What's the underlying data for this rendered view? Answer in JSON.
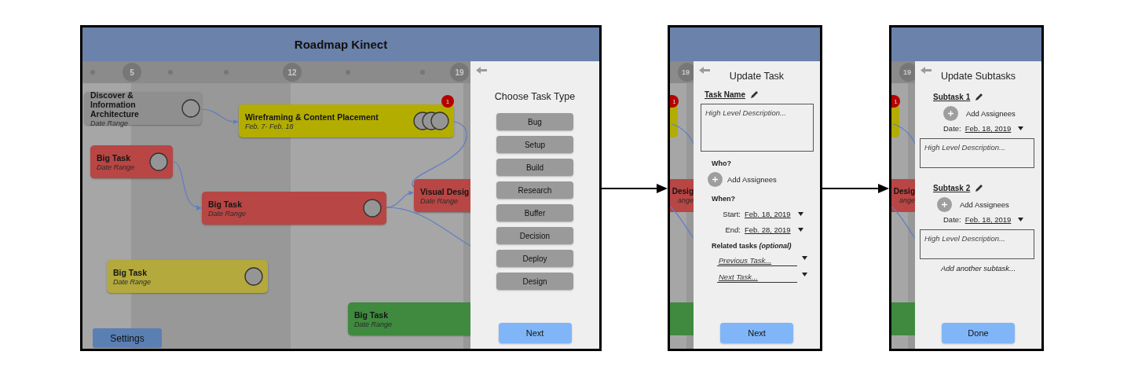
{
  "screen_1": {
    "title": "Roadmap Kinect",
    "timeline": [
      {
        "kind": "dot"
      },
      {
        "kind": "week",
        "label": "5"
      },
      {
        "kind": "dot"
      },
      {
        "kind": "dot"
      },
      {
        "kind": "week",
        "label": "12"
      },
      {
        "kind": "dot"
      },
      {
        "kind": "dot"
      },
      {
        "kind": "week",
        "label": "19"
      }
    ],
    "tasks": [
      {
        "title": "Discover & Information Architecture",
        "dates": "Date Range",
        "color": "#8f8f8f",
        "assignees": [
          {
            "kind": "avatar"
          }
        ]
      },
      {
        "title": "Wireframing & Content Placement",
        "dates": "Feb. 7- Feb. 18",
        "color": "#b3ad00",
        "badge": "1",
        "assignees": [
          {
            "kind": "avatar"
          },
          {
            "kind": "avatar"
          },
          {
            "kind": "avatar"
          }
        ]
      },
      {
        "title": "Big Task",
        "dates": "Date Range",
        "color": "#b84644",
        "assignees": [
          {
            "kind": "avatar"
          }
        ]
      },
      {
        "title": "Big Task",
        "dates": "Date Range",
        "color": "#b84644",
        "assignees": [
          {
            "kind": "avatar"
          }
        ]
      },
      {
        "title": "Visual Desig",
        "dates": "Date Range",
        "color": "#b84644"
      },
      {
        "title": "Big Task",
        "dates": "Date Range",
        "color": "#b3a93c",
        "assignees": [
          {
            "kind": "avatar"
          }
        ]
      },
      {
        "title": "Big Task",
        "dates": "Date Range",
        "color": "#3f8a3f"
      }
    ],
    "settings_button": "Settings",
    "panel": {
      "title": "Choose Task Type",
      "options": [
        "Bug",
        "Setup",
        "Build",
        "Research",
        "Buffer",
        "Decision",
        "Deploy",
        "Design"
      ],
      "next_button": "Next"
    }
  },
  "screen_2": {
    "strip": {
      "week": "19",
      "badge": "1",
      "task_title": "Desig",
      "task_dates": "ange"
    },
    "panel": {
      "title": "Update Task",
      "task_name": "Task Name",
      "description": {
        "placeholder": "High Level Description..."
      },
      "who_label": "Who?",
      "add_assignees": "Add Assignees",
      "when_label": "When?",
      "start": {
        "label": "Start:",
        "value": "Feb. 18, 2019"
      },
      "end": {
        "label": "End:",
        "value": "Feb. 28, 2019"
      },
      "related_label": "Related tasks *(optional)*",
      "previous_task": {
        "placeholder": "Previous Task..."
      },
      "next_task": {
        "placeholder": "Next Task..."
      },
      "next_button": "Next"
    }
  },
  "screen_3": {
    "strip": {
      "week": "19",
      "badge": "1",
      "task_title": "Desig",
      "task_dates": "ange"
    },
    "panel": {
      "title": "Update Subtasks",
      "subtasks": [
        {
          "name": "Subtask 1",
          "add_assignees": "Add Assignees",
          "date_label": "Date:",
          "date": "Feb. 18, 2019",
          "description": {
            "placeholder": "High Level Description..."
          }
        },
        {
          "name": "Subtask 2",
          "add_assignees": "Add Assignees",
          "date_label": "Date:",
          "date": "Feb. 18, 2019",
          "description": {
            "placeholder": "High Level Description..."
          }
        }
      ],
      "add_another": "Add another subtask...",
      "done_button": "Done"
    }
  }
}
